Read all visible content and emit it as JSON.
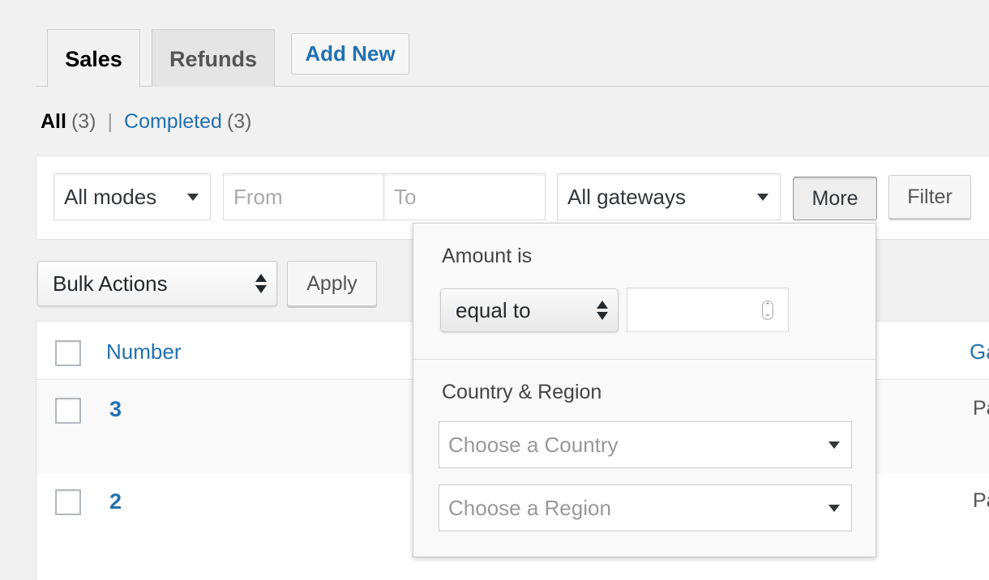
{
  "tabs": [
    {
      "label": "Sales",
      "active": true
    },
    {
      "label": "Refunds",
      "active": false
    }
  ],
  "add_new_label": "Add New",
  "views": {
    "all_label": "All",
    "all_count": "(3)",
    "separator": "|",
    "completed_label": "Completed",
    "completed_count": "(3)"
  },
  "filters": {
    "mode_value": "All modes",
    "from_placeholder": "From",
    "to_placeholder": "To",
    "gateway_value": "All gateways",
    "more_label": "More",
    "filter_label": "Filter"
  },
  "bulk": {
    "select_value": "Bulk Actions",
    "apply_label": "Apply"
  },
  "table": {
    "columns": [
      "Number",
      "Ga"
    ],
    "rows": [
      {
        "number": "3",
        "gateway": "Pa"
      },
      {
        "number": "2",
        "gateway": "Pa"
      }
    ]
  },
  "more_panel": {
    "amount_label": "Amount is",
    "operator_value": "equal to",
    "amount_value": "",
    "country_region_label": "Country & Region",
    "country_placeholder": "Choose a Country",
    "region_placeholder": "Choose a Region"
  },
  "colors": {
    "link": "#2271b1",
    "background": "#f1f1f1"
  }
}
